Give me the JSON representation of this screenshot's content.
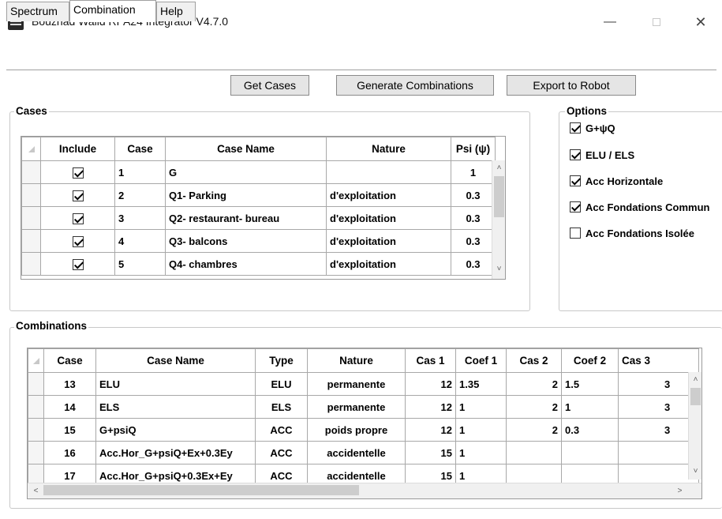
{
  "window": {
    "title": "Bouznad Walid RPA24 Integrator V4.7.0"
  },
  "tabs": [
    {
      "label": "Spectrum"
    },
    {
      "label": "Combination"
    },
    {
      "label": "Help"
    }
  ],
  "toolbar": {
    "get_cases": "Get Cases",
    "generate": "Generate Combinations",
    "export": "Export to Robot"
  },
  "cases": {
    "title": "Cases",
    "columns": [
      "Include",
      "Case",
      "Case Name",
      "Nature",
      "Psi (ψ)"
    ],
    "rows": [
      {
        "include": true,
        "case": "1",
        "name": "G",
        "nature": "",
        "psi": "1"
      },
      {
        "include": true,
        "case": "2",
        "name": "Q1- Parking",
        "nature": "d'exploitation",
        "psi": "0.3"
      },
      {
        "include": true,
        "case": "3",
        "name": "Q2- restaurant- bureau",
        "nature": "d'exploitation",
        "psi": "0.3"
      },
      {
        "include": true,
        "case": "4",
        "name": "Q3- balcons",
        "nature": "d'exploitation",
        "psi": "0.3"
      },
      {
        "include": true,
        "case": "5",
        "name": "Q4- chambres",
        "nature": "d'exploitation",
        "psi": "0.3"
      }
    ]
  },
  "options": {
    "title": "Options",
    "items": [
      {
        "label": "G+ψQ",
        "checked": true
      },
      {
        "label": "ELU / ELS",
        "checked": true
      },
      {
        "label": "Acc Horizontale",
        "checked": true
      },
      {
        "label": "Acc Fondations Commun",
        "checked": true
      },
      {
        "label": "Acc Fondations Isolée",
        "checked": false
      }
    ]
  },
  "combinations": {
    "title": "Combinations",
    "columns": [
      "Case",
      "Case Name",
      "Type",
      "Nature",
      "Cas 1",
      "Coef 1",
      "Cas 2",
      "Coef 2",
      "Cas 3"
    ],
    "rows": [
      {
        "case": "13",
        "name": "ELU",
        "type": "ELU",
        "nature": "permanente",
        "cas1": "12",
        "coef1": "1.35",
        "cas2": "2",
        "coef2": "1.5",
        "cas3": "3"
      },
      {
        "case": "14",
        "name": "ELS",
        "type": "ELS",
        "nature": "permanente",
        "cas1": "12",
        "coef1": "1",
        "cas2": "2",
        "coef2": "1",
        "cas3": "3"
      },
      {
        "case": "15",
        "name": "G+psiQ",
        "type": "ACC",
        "nature": "poids propre",
        "cas1": "12",
        "coef1": "1",
        "cas2": "2",
        "coef2": "0.3",
        "cas3": "3"
      },
      {
        "case": "16",
        "name": "Acc.Hor_G+psiQ+Ex+0.3Ey",
        "type": "ACC",
        "nature": "accidentelle",
        "cas1": "15",
        "coef1": "1",
        "cas2": "",
        "coef2": "",
        "cas3": ""
      },
      {
        "case": "17",
        "name": "Acc.Hor_G+psiQ+0.3Ex+Ey",
        "type": "ACC",
        "nature": "accidentelle",
        "cas1": "15",
        "coef1": "1",
        "cas2": "",
        "coef2": "",
        "cas3": ""
      }
    ]
  },
  "icons": {
    "minimize": "minimize-icon",
    "maximize": "maximize-icon",
    "close": "close-icon",
    "scroll_up": "chevron-up-icon",
    "scroll_down": "chevron-down-icon",
    "scroll_left": "chevron-left-icon",
    "scroll_right": "chevron-right-icon"
  }
}
